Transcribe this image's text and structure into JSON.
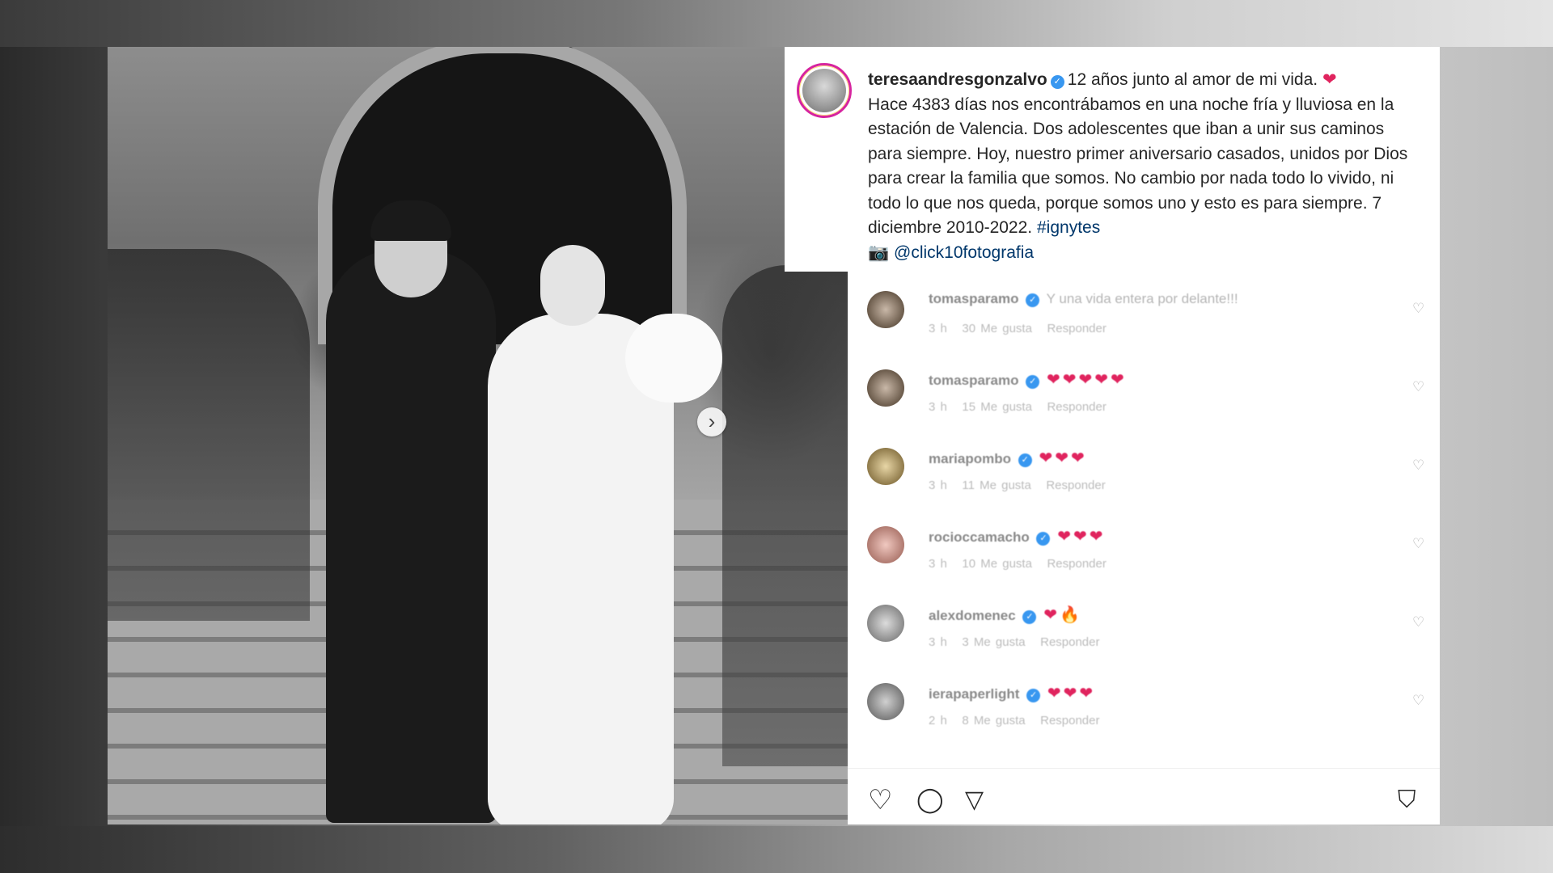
{
  "post": {
    "username": "teresaandresgonzalvo",
    "caption_line1": "12 años junto al amor de mi vida.",
    "caption_body": "Hace 4383 días nos encontrábamos en una noche fría y lluviosa en la estación de Valencia. Dos adolescentes que iban a unir sus caminos para siempre. Hoy, nuestro primer aniversario casados, unidos por Dios para crear la familia que somos. No cambio por nada todo lo vivido, ni todo lo que nos queda, porque somos uno y esto es para siempre. 7 diciembre 2010-2022.",
    "hashtag": "#ignytes",
    "camera_glyph": "📷",
    "credit": "@click10fotografia",
    "heart_glyph": "❤"
  },
  "comments": [
    {
      "user": "tomasparamo",
      "text": "Y una vida entera por delante!!!",
      "hearts": "",
      "time": "3 h",
      "likes": "30 Me gusta",
      "reply": "Responder"
    },
    {
      "user": "tomasparamo",
      "text": "",
      "hearts": "❤❤❤❤❤",
      "time": "3 h",
      "likes": "15 Me gusta",
      "reply": "Responder"
    },
    {
      "user": "mariapombo",
      "text": "",
      "hearts": "❤❤❤",
      "time": "3 h",
      "likes": "11 Me gusta",
      "reply": "Responder"
    },
    {
      "user": "rocioccamacho",
      "text": "",
      "hearts": "❤❤❤",
      "time": "3 h",
      "likes": "10 Me gusta",
      "reply": "Responder"
    },
    {
      "user": "alexdomenec",
      "text": "",
      "hearts": "❤🔥",
      "time": "3 h",
      "likes": "3 Me gusta",
      "reply": "Responder"
    },
    {
      "user": "ierapaperlight",
      "text": "",
      "hearts": "❤❤❤",
      "time": "2 h",
      "likes": "8 Me gusta",
      "reply": "Responder"
    }
  ],
  "icons": {
    "like": "♡",
    "comment": "◯",
    "share": "▽",
    "save": "⛉",
    "next_arrow": "›",
    "verified": "✓"
  },
  "colors": {
    "verified": "#3897f0",
    "heart": "#e0245e",
    "text": "#262626"
  }
}
